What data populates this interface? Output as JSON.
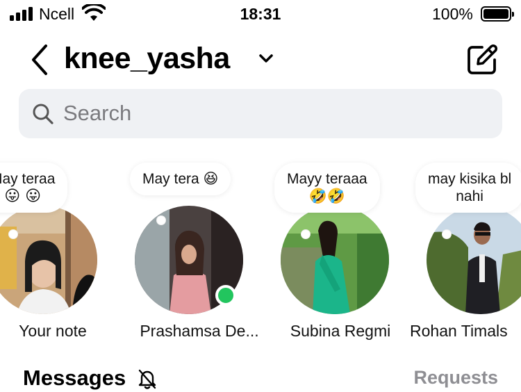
{
  "status_bar": {
    "carrier": "Ncell",
    "time": "18:31",
    "battery_percent": "100%",
    "battery_level": 1.0
  },
  "header": {
    "title": "knee_yasha",
    "icons": [
      "back-chevron-icon",
      "chevron-down-icon",
      "compose-icon"
    ]
  },
  "search": {
    "placeholder": "Search"
  },
  "notes": [
    {
      "note_text_line1": "May teraa",
      "note_text_line2": "😛 😛",
      "name": "Your note",
      "online": false
    },
    {
      "note_text_line1": "May tera 😆",
      "note_text_line2": "",
      "name": "Prashamsa De...",
      "online": true
    },
    {
      "note_text_line1": "Mayy teraaa",
      "note_text_line2": "🤣🤣",
      "name": "Subina Regmi",
      "online": false
    },
    {
      "note_text_line1": "may kisika bl",
      "note_text_line2": "nahi",
      "name": "Rohan Timals",
      "online": false
    }
  ],
  "messages": {
    "title": "Messages",
    "requests_label": "Requests",
    "muted_icon": "bell-slash-icon"
  },
  "colors": {
    "search_bg": "#eff1f4",
    "online": "#22c55e",
    "secondary_text": "#8e8e93"
  }
}
